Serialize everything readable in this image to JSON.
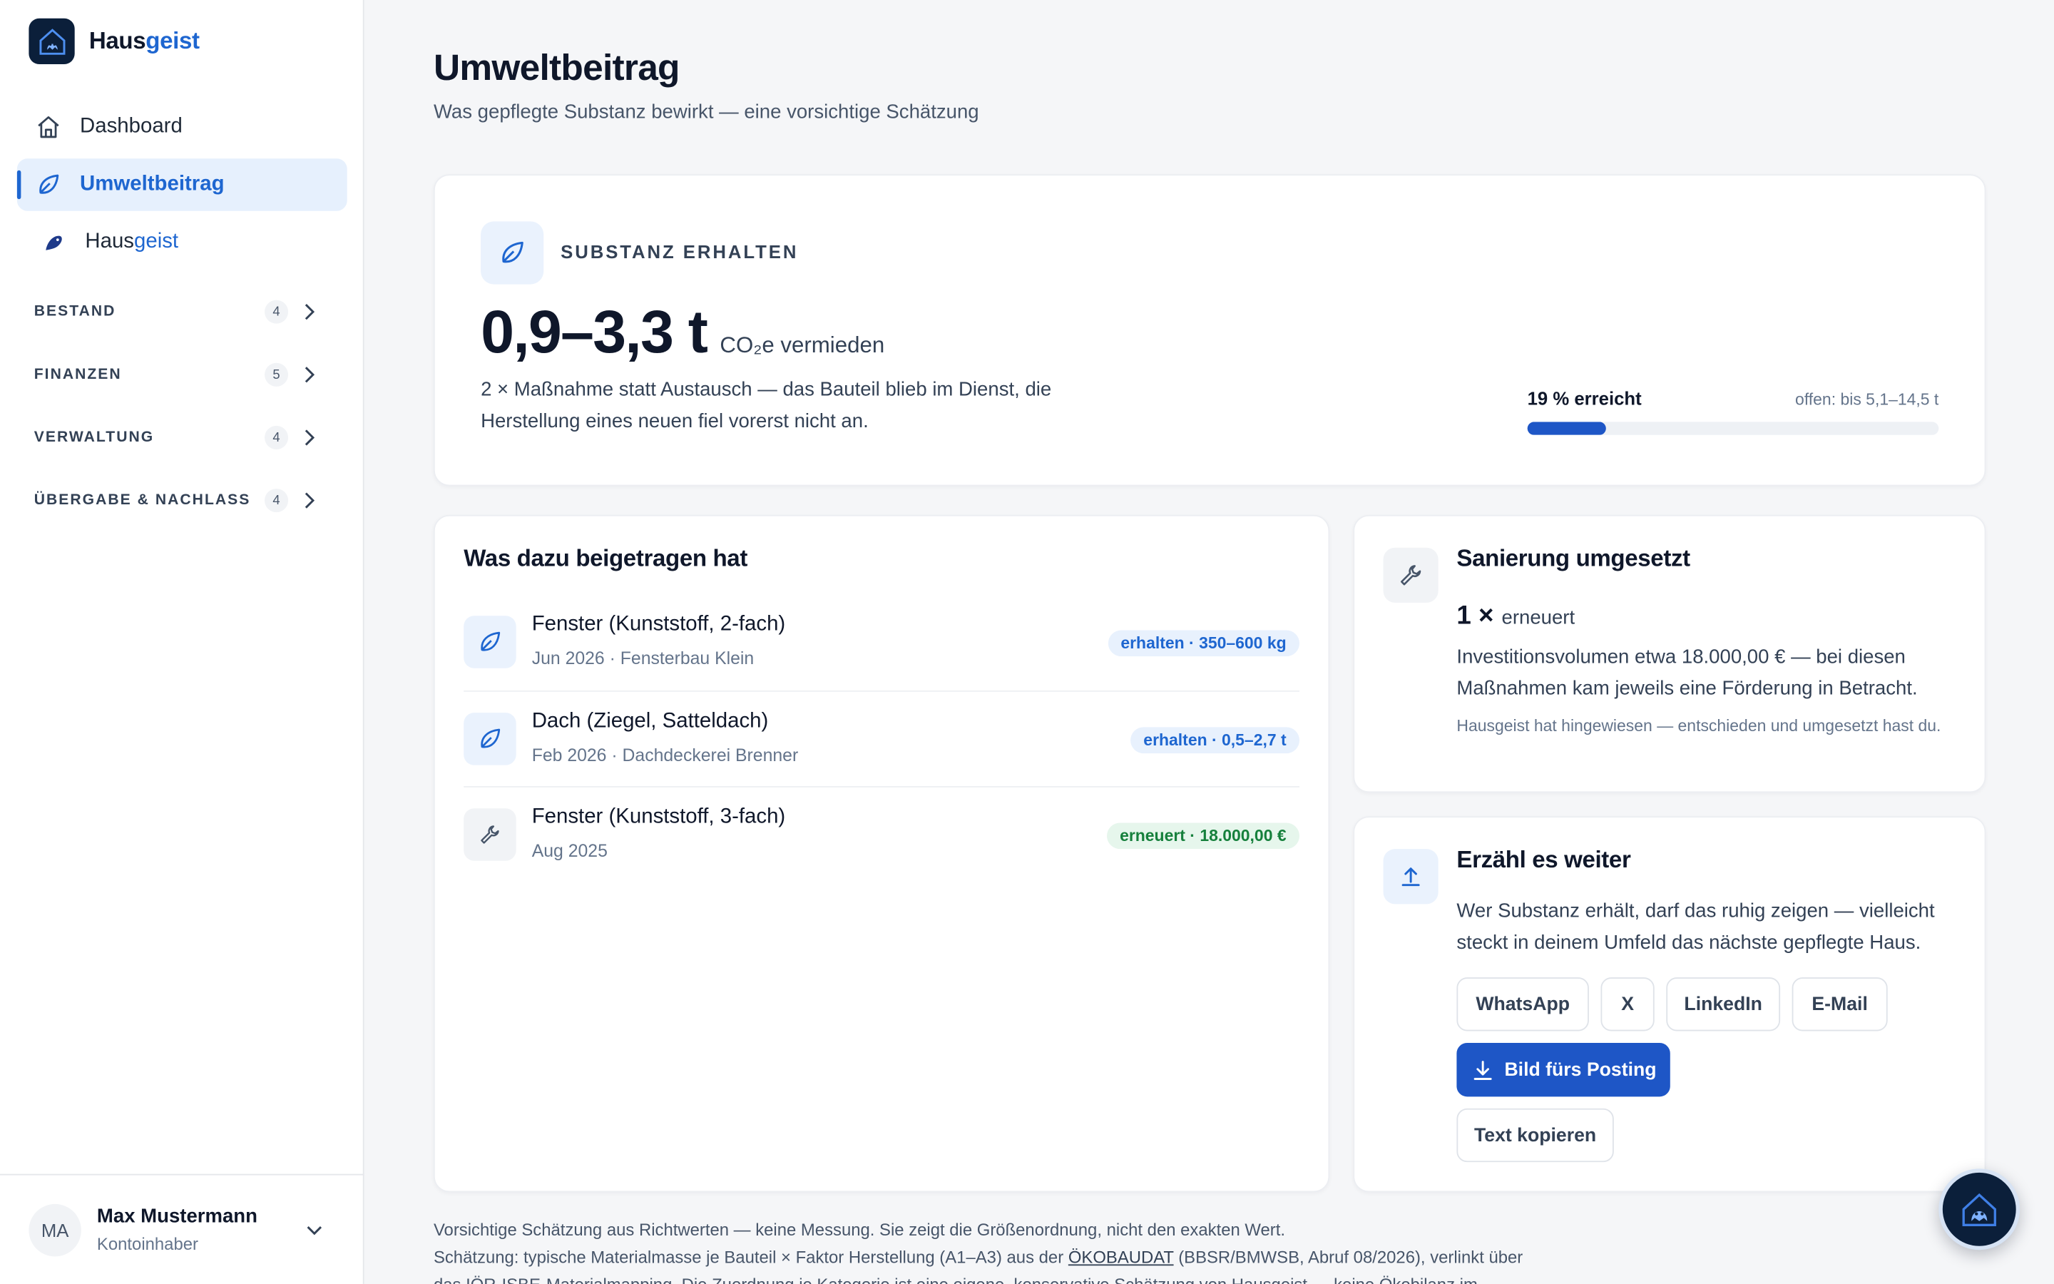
{
  "brand": {
    "name_part1": "Haus",
    "name_part2": "geist"
  },
  "nav": {
    "dashboard": "Dashboard",
    "umweltbeitrag": "Umweltbeitrag",
    "hausgeist_part1": "Haus",
    "hausgeist_part2": "geist"
  },
  "groups": [
    {
      "label": "BESTAND",
      "count": "4"
    },
    {
      "label": "FINANZEN",
      "count": "5"
    },
    {
      "label": "VERWALTUNG",
      "count": "4"
    },
    {
      "label": "ÜBERGABE & NACHLASS",
      "count": "4"
    }
  ],
  "user": {
    "initials": "MA",
    "name": "Max Mustermann",
    "role": "Kontoinhaber"
  },
  "page": {
    "title": "Umweltbeitrag",
    "subtitle": "Was gepflegte Substanz bewirkt — eine vorsichtige Schätzung"
  },
  "hero": {
    "eyebrow": "SUBSTANZ ERHALTEN",
    "value": "0,9–3,3 t",
    "unit": "CO₂e vermieden",
    "description": "2 × Maßnahme statt Austausch — das Bauteil blieb im Dienst, die Herstellung eines neuen fiel vorerst nicht an.",
    "progress_label": "19 % erreicht",
    "progress_open": "offen: bis 5,1–14,5 t",
    "progress_percent": 19
  },
  "contrib": {
    "title": "Was dazu beigetragen hat",
    "items": [
      {
        "title": "Fenster (Kunststoff, 2-fach)",
        "sub": "Jun 2026 · Fensterbau Klein",
        "pill": "erhalten · 350–600 kg"
      },
      {
        "title": "Dach (Ziegel, Satteldach)",
        "sub": "Feb 2026 · Dachdeckerei Brenner",
        "pill": "erhalten · 0,5–2,7 t"
      },
      {
        "title": "Fenster (Kunststoff, 3-fach)",
        "sub": "Aug 2025",
        "pill": "erneuert · 18.000,00 €"
      }
    ]
  },
  "sanierung": {
    "title": "Sanierung umgesetzt",
    "count": "1 ×",
    "count_unit": "erneuert",
    "description": "Investitionsvolumen etwa 18.000,00 € — bei diesen Maßnahmen kam jeweils eine Förderung in Betracht.",
    "note": "Hausgeist hat hingewiesen — entschieden und umgesetzt hast du."
  },
  "share": {
    "title": "Erzähl es weiter",
    "description": "Wer Substanz erhält, darf das ruhig zeigen — vielleicht steckt in deinem Umfeld das nächste gepflegte Haus.",
    "buttons": {
      "whatsapp": "WhatsApp",
      "x": "X",
      "linkedin": "LinkedIn",
      "email": "E-Mail"
    },
    "download": "Bild fürs Posting",
    "copy": "Text kopieren"
  },
  "footer": {
    "line1": "Vorsichtige Schätzung aus Richtwerten — keine Messung. Sie zeigt die Größenordnung, nicht den exakten Wert.",
    "line2_pre": "Schätzung: typische Materialmasse je Bauteil × Faktor Herstellung (A1–A3) aus der ",
    "line2_link": "ÖKOBAUDAT",
    "line2_post": " (BBSR/BMWSB, Abruf 08/2026), verlinkt über",
    "line3": "das IÖR-ISBE-Materialmapping. Die Zuordnung je Kategorie ist eine eigene, konservative Schätzung von Hausgeist — keine Ökobilanz im"
  },
  "colors": {
    "accent": "#1e66d0",
    "primary_button": "#1e56c6",
    "success": "#16803c"
  }
}
